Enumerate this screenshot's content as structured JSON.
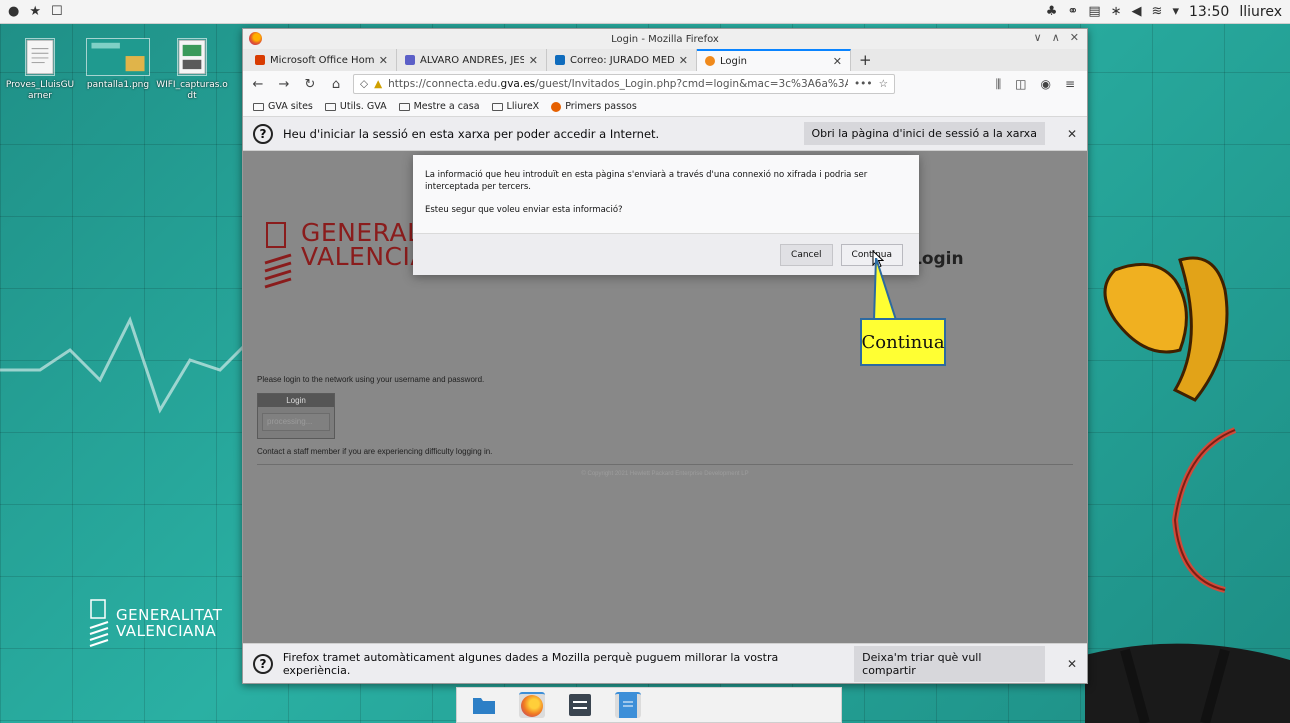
{
  "system_panel": {
    "time": "13:50",
    "user": "lliurex"
  },
  "desktop": {
    "icons": [
      {
        "label": "Proves_LluisGU arner"
      },
      {
        "label": "pantalla1.png"
      },
      {
        "label": "WIFI_capturas.o dt"
      }
    ],
    "logo_line1": "GENERALITAT",
    "logo_line2": "VALENCIANA"
  },
  "firefox": {
    "window_title": "Login - Mozilla Firefox",
    "tabs": [
      {
        "title": "Microsoft Office Home",
        "color": "#d83b01"
      },
      {
        "title": "ÁLVARO ANDRÉS, JESÚS | ",
        "color": "#5b5fc7"
      },
      {
        "title": "Correo: JURADO MEDINA",
        "color": "#0f6cbd"
      },
      {
        "title": "Login",
        "color": "#f08a1c"
      }
    ],
    "url_prefix": "https://connecta.edu.",
    "url_domain": "gva.es",
    "url_path": "/guest/Invitados_Login.php?cmd=login&mac=3c%3A6a%3Aa7%3A3c%3Ab2%",
    "bookmarks": [
      "GVA sites",
      "Utils. GVA",
      "Mestre a casa",
      "LliureX",
      "Primers passos"
    ],
    "captive_notice": "Heu d'iniciar la sessió en esta xarxa per poder accedir a Internet.",
    "captive_button": "Obri la pàgina d'inici de sessió a la xarxa",
    "bottom_notice": "Firefox tramet automàticament algunes dades a Mozilla perquè puguem millorar la vostra experiència.",
    "bottom_button": "Deixa'm triar què vull compartir"
  },
  "page": {
    "logo_line1": "GENERALITAT",
    "logo_line2": "VALENCIANA",
    "login_title": "Login",
    "please_text": "Please login to the network using your username and password.",
    "login_box_title": "Login",
    "processing": "processing...",
    "contact_text": "Contact a staff member if you are experiencing difficulty logging in.",
    "copyright": "© Copyright 2021 Hewlett Packard Enterprise Development LP"
  },
  "modal": {
    "message": "La informació que heu introduït en esta pàgina s'enviarà a través d'una connexió no xifrada i podria ser interceptada per tercers.",
    "question": "Esteu segur que voleu enviar esta informació?",
    "cancel_label": "Cancel",
    "continue_label": "Continua"
  },
  "annotation": {
    "callout_text": "Continua"
  }
}
